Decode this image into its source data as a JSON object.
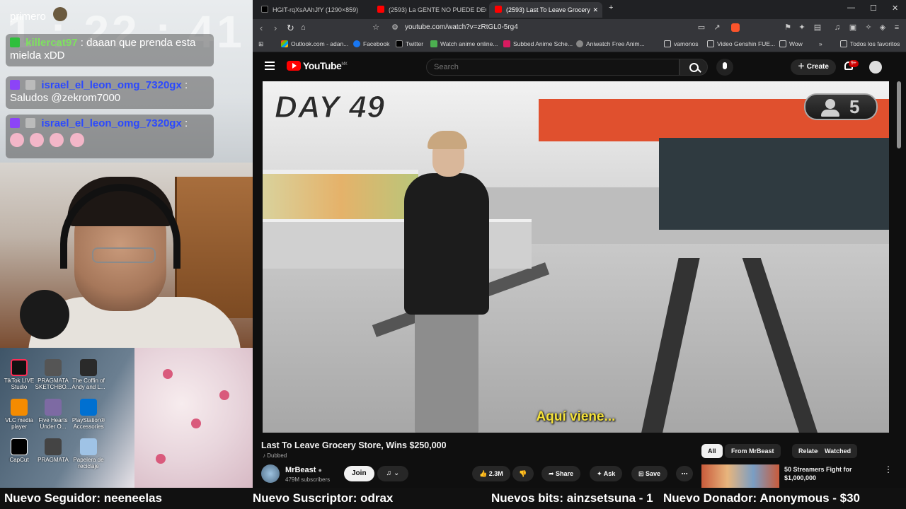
{
  "overlay": {
    "clock": "1 : 22 : 41",
    "chat": [
      {
        "user": "",
        "message": "primero"
      },
      {
        "user": "killercat97",
        "message": ": daaan que prenda esta mielda xDD"
      },
      {
        "user": "israel_el_leon_omg_7320gx",
        "message": ": Saludos @zekrom7000"
      },
      {
        "user": "israel_el_leon_omg_7320gx",
        "message": ":"
      }
    ],
    "desktop_icons": [
      {
        "label": "TikTok LIVE Studio",
        "icon": "tiktok-icon"
      },
      {
        "label": "PRAGMATA SKETCHBO...",
        "icon": "game-icon"
      },
      {
        "label": "The Coffin of Andy and L...",
        "icon": "game-icon"
      },
      {
        "label": "VLC media player",
        "icon": "vlc-icon"
      },
      {
        "label": "Five Hearts Under O...",
        "icon": "game-icon"
      },
      {
        "label": "PlayStation® Accessories",
        "icon": "playstation-icon"
      },
      {
        "label": "CapCut",
        "icon": "capcut-icon"
      },
      {
        "label": "PRAGMATA",
        "icon": "game-icon"
      },
      {
        "label": "Papelera de reciclaje",
        "icon": "recycle-bin-icon"
      }
    ]
  },
  "browser": {
    "tabs": [
      {
        "label": "HGIT-rqXsAAhJfY (1290×859)",
        "icon": "x-icon",
        "active": false
      },
      {
        "label": "(2593) La GENTE NO PUEDE DECIDIR",
        "icon": "youtube-icon",
        "active": false
      },
      {
        "label": "(2593) Last To Leave Grocery",
        "icon": "youtube-icon",
        "active": true
      }
    ],
    "url": "youtube.com/watch?v=zRtGL0-5rg4",
    "bookmarks": [
      "Outlook.com - adan...",
      "Facebook",
      "Twitter",
      "Watch anime online...",
      "Subbed Anime Sche...",
      "Aniwatch Free Anim...",
      "vamonos",
      "Video Genshin FUE...",
      "Wow",
      "Todos los favoritos"
    ]
  },
  "youtube": {
    "logo": "YouTube",
    "region": "MX",
    "search_placeholder": "Search",
    "create_label": "Create",
    "notif_count": "9+",
    "video": {
      "overlay_day": "DAY 49",
      "overlay_count": "5",
      "subtitle": "Aquí viene..."
    },
    "title": "Last To Leave Grocery Store, Wins $250,000",
    "dubbed": "Dubbed",
    "channel": {
      "name": "MrBeast",
      "subs": "479M subscribers"
    },
    "join_label": "Join",
    "likes": "2.3M",
    "share_label": "Share",
    "ask_label": "Ask",
    "save_label": "Save",
    "chips": [
      "All",
      "From MrBeast",
      "Related",
      "Watched"
    ],
    "recommended": {
      "title": "50 Streamers Fight for $1,000,000"
    }
  },
  "ticker": {
    "follower": "Nuevo Seguidor: neeneelas",
    "subscriber": "Nuevo Suscriptor: odrax",
    "bits": "Nuevos bits: ainzsetsuna - 1",
    "donor": "Nuevo Donador: Anonymous - $30"
  },
  "colors": {
    "accent": "#ff0000",
    "subtitle": "#f5e23a",
    "chat_user": "#2b49ff"
  }
}
